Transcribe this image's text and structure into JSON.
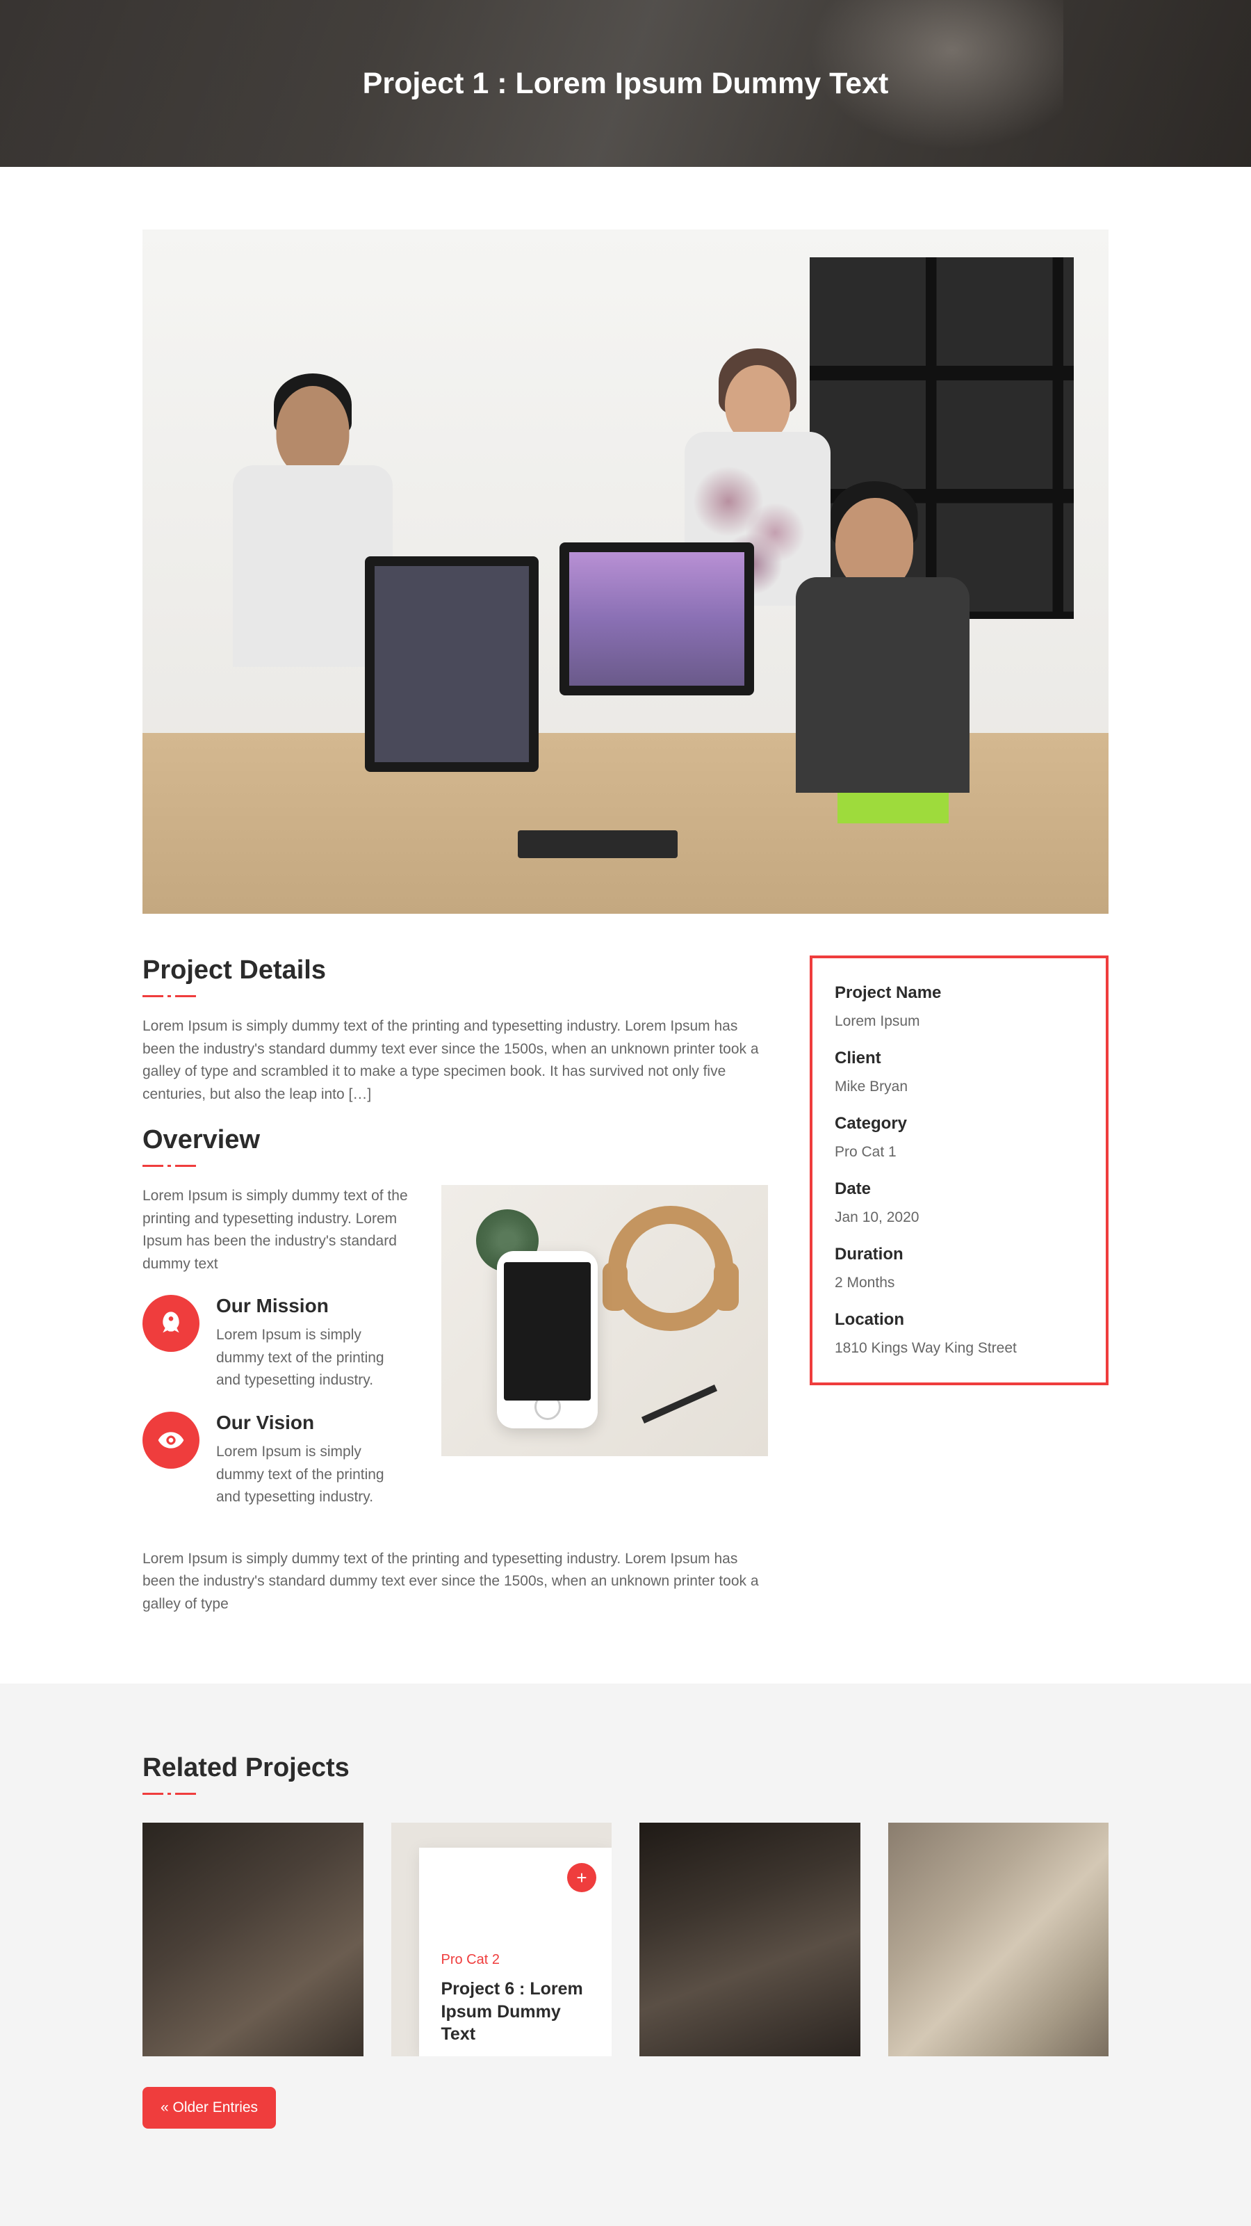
{
  "hero": {
    "title": "Project 1 : Lorem Ipsum Dummy Text"
  },
  "details": {
    "heading": "Project Details",
    "text": "Lorem Ipsum is simply dummy text of the printing and typesetting industry. Lorem Ipsum has been the industry's standard dummy text ever since the 1500s, when an unknown printer took a galley of type and scrambled it to make a type specimen book. It has survived not only five centuries, but also the leap into […]"
  },
  "info": [
    {
      "label": "Project Name",
      "value": "Lorem Ipsum"
    },
    {
      "label": "Client",
      "value": "Mike Bryan"
    },
    {
      "label": "Category",
      "value": "Pro Cat 1"
    },
    {
      "label": "Date",
      "value": "Jan 10, 2020"
    },
    {
      "label": "Duration",
      "value": "2 Months"
    },
    {
      "label": "Location",
      "value": "1810 Kings Way King Street"
    }
  ],
  "overview": {
    "heading": "Overview",
    "intro": "Lorem Ipsum is simply dummy text of the printing and typesetting industry. Lorem Ipsum has been the industry's standard dummy text",
    "mission": {
      "title": "Our Mission",
      "text": "Lorem Ipsum is simply dummy text of the printing and typesetting industry."
    },
    "vision": {
      "title": "Our Vision",
      "text": "Lorem Ipsum is simply dummy text of the printing and typesetting industry."
    },
    "footer": "Lorem Ipsum is simply dummy text of the printing and typesetting industry. Lorem Ipsum has been the industry's standard dummy text ever since the 1500s, when an unknown printer took a galley of type"
  },
  "related": {
    "heading": "Related Projects",
    "hover_cat": "Pro Cat 2",
    "hover_title": "Project 6 : Lorem Ipsum Dummy Text",
    "older": "« Older Entries"
  }
}
